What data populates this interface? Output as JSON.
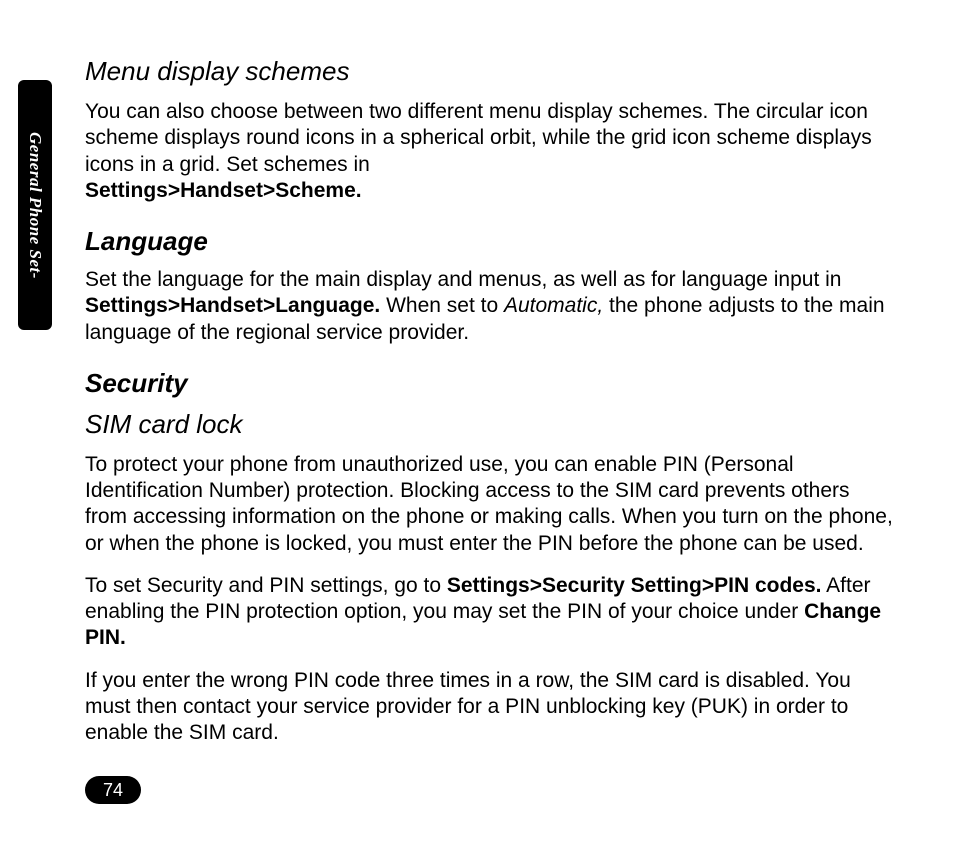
{
  "side_tab": "General Phone Set-",
  "page_number": "74",
  "sections": {
    "menu_display": {
      "heading": "Menu display schemes",
      "text": "You can also choose between two different menu display schemes. The circular icon scheme displays round icons in a spherical orbit, while the grid icon scheme displays icons in a grid. Set schemes in ",
      "path": "Settings>Handset>Scheme."
    },
    "language": {
      "heading": "Language",
      "text_pre": "Set the language for the main display and menus, as well as for language input in ",
      "path": "Settings>Handset>Language.",
      "text_mid": " When set to ",
      "italic": "Automatic,",
      "text_post": " the phone adjusts to the main language of the regional service provider."
    },
    "security": {
      "heading": "Security",
      "sim_heading": "SIM card lock",
      "p1": "To protect your phone from unauthorized use, you can enable PIN (Personal Identification Number) protection. Blocking access to the SIM card prevents others from accessing information on the phone or making calls. When you turn on the phone, or when the phone is locked, you must enter the PIN before the phone can be used.",
      "p2_pre": "To set Security and PIN settings, go to ",
      "p2_path1": "Settings>Security Setting>PIN codes.",
      "p2_mid": " After enabling the PIN protection option, you may set the PIN of your choice under ",
      "p2_path2": "Change PIN.",
      "p3": "If you enter the wrong PIN code three times in a row, the SIM card is disabled. You must then contact your service provider for a PIN unblocking key (PUK) in order to enable the SIM card."
    }
  }
}
